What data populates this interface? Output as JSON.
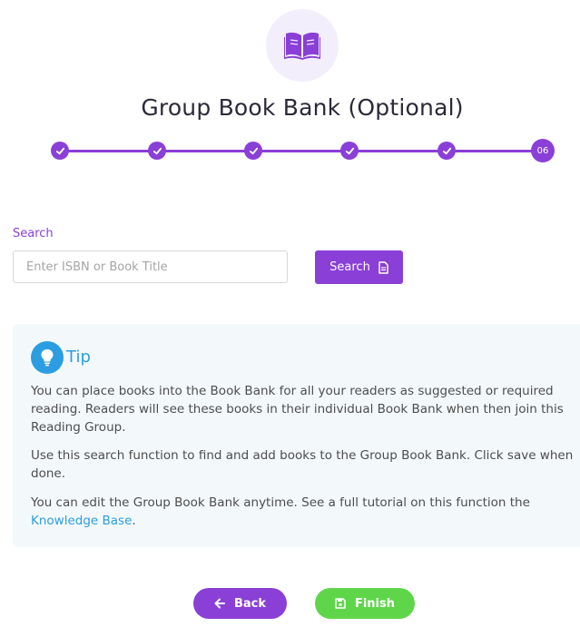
{
  "header": {
    "icon": "open-book-icon",
    "title": "Group Book Bank (Optional)"
  },
  "stepper": {
    "completed_icon": "check-icon",
    "current_label": "06",
    "completed_count": 5,
    "accent_color": "#8a3fd6"
  },
  "search": {
    "label": "Search",
    "placeholder": "Enter ISBN or Book Title",
    "value": "",
    "button_label": "Search",
    "button_icon": "document-icon"
  },
  "tip": {
    "icon": "lightbulb-icon",
    "title": "Tip",
    "paragraph1": "You can place books into the Book Bank for all your readers as suggested or required reading. Readers will see these books in their individual Book Bank when then join this Reading Group.",
    "paragraph2": "Use this search function to find and add books to the Group Book Bank. Click save when done.",
    "paragraph3_before": "You can edit the Group Book Bank anytime. See a full tutorial on this function the ",
    "paragraph3_link": "Knowledge Base",
    "paragraph3_after": ".",
    "accent_color": "#2b9de0"
  },
  "footer": {
    "back_label": "Back",
    "back_icon": "arrow-left-icon",
    "finish_label": "Finish",
    "finish_icon": "save-icon",
    "finish_color": "#5fd64a"
  }
}
